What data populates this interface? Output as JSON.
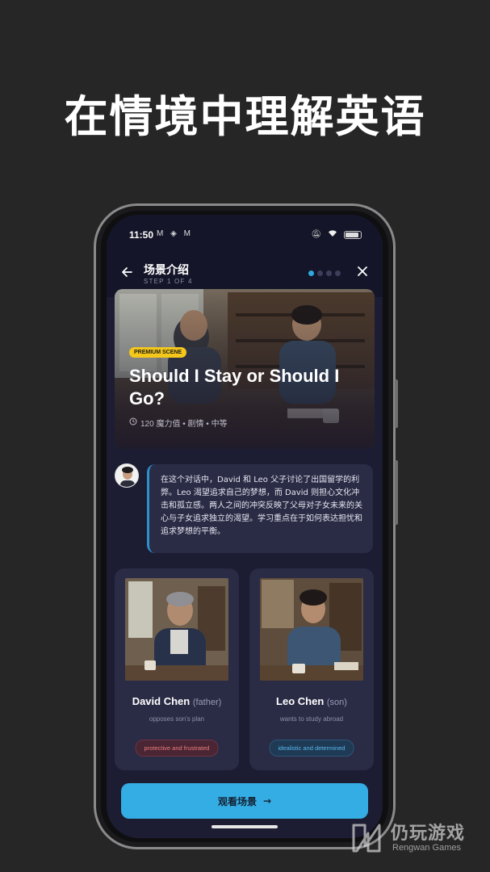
{
  "promo": {
    "title": "在情境中理解英语"
  },
  "status_bar": {
    "time": "11:50",
    "apps": "M ◈ M"
  },
  "header": {
    "title": "场景介绍",
    "step": "STEP 1 OF 4",
    "total_steps": 4,
    "current_step": 1
  },
  "scene": {
    "badge": "PREMIUM SCENE",
    "title": "Should I Stay or Should I Go?",
    "meta": "120 魔力值 • 剧情 • 中等"
  },
  "narration": {
    "text": "在这个对话中，David 和 Leo 父子讨论了出国留学的利弊。Leo 渴望追求自己的梦想，而 David 则担心文化冲击和孤立感。两人之间的冲突反映了父母对子女未来的关心与子女追求独立的渴望。学习重点在于如何表达担忧和追求梦想的平衡。"
  },
  "characters": [
    {
      "name": "David Chen",
      "role": "(father)",
      "description": "opposes son's plan",
      "tag": "protective and frustrated"
    },
    {
      "name": "Leo Chen",
      "role": "(son)",
      "description": "wants to study abroad",
      "tag": "idealistic and determined"
    }
  ],
  "cta": {
    "label": "观看场景",
    "arrow": "→"
  },
  "watermark": {
    "cn": "仍玩游戏",
    "en": "Rengwan Games"
  },
  "colors": {
    "accent": "#33ade3",
    "badge": "#f4c81b",
    "card": "#2a2b45",
    "screen_bg": "#1c1d33"
  }
}
